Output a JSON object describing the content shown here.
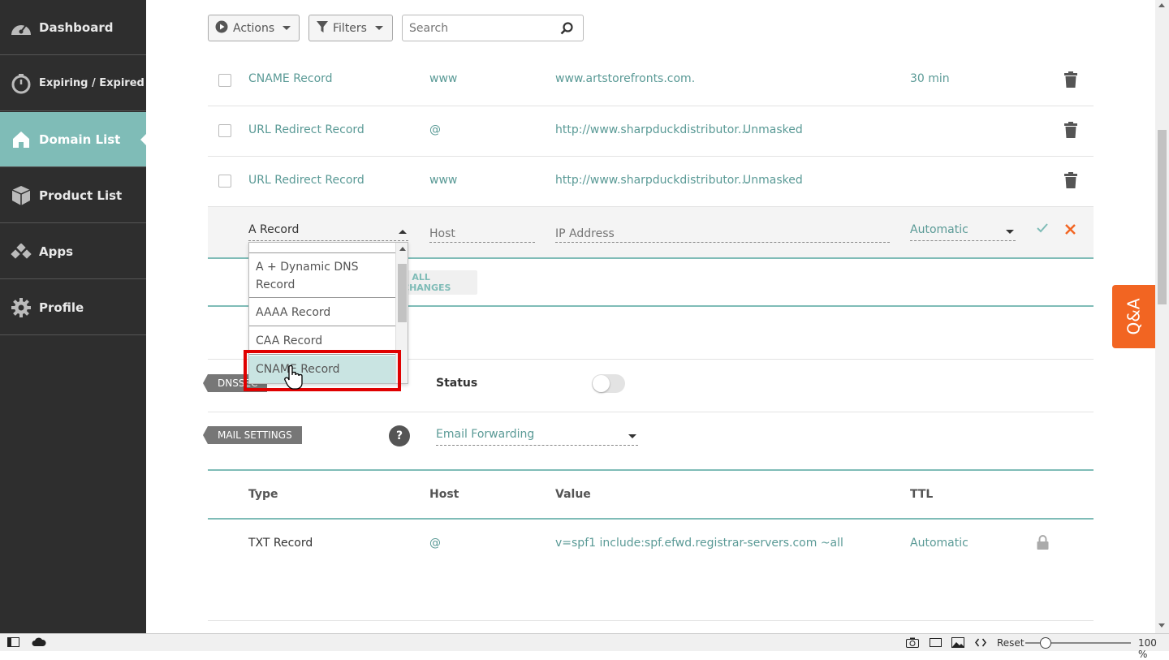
{
  "sidebar": {
    "items": [
      {
        "label": "Dashboard",
        "icon": "gauge-icon"
      },
      {
        "label": "Expiring / Expired",
        "icon": "timer-icon"
      },
      {
        "label": "Domain List",
        "icon": "home-icon",
        "active": true
      },
      {
        "label": "Product List",
        "icon": "box-icon"
      },
      {
        "label": "Apps",
        "icon": "apps-icon"
      },
      {
        "label": "Profile",
        "icon": "gear-icon"
      }
    ]
  },
  "toolbar": {
    "actions_label": "Actions",
    "filters_label": "Filters",
    "search_placeholder": "Search"
  },
  "records": [
    {
      "type": "CNAME Record",
      "host": "www",
      "value": "www.artstorefronts.com.",
      "extra": "",
      "ttl": "30 min"
    },
    {
      "type": "URL Redirect Record",
      "host": "@",
      "value": "http://www.sharpduckdistributor...",
      "extra": "Unmasked",
      "ttl": ""
    },
    {
      "type": "URL Redirect Record",
      "host": "www",
      "value": "http://www.sharpduckdistributor...",
      "extra": "Unmasked",
      "ttl": ""
    }
  ],
  "new_record": {
    "type_selected": "A Record",
    "host_placeholder": "Host",
    "value_placeholder": "IP Address",
    "ttl_selected": "Automatic"
  },
  "type_dropdown": {
    "options": [
      "A + Dynamic DNS Record",
      "AAAA Record",
      "CAA Record",
      "CNAME Record"
    ],
    "highlighted": "CNAME Record"
  },
  "save_all_label": "E ALL CHANGES",
  "dnssec": {
    "tag": "DNSSEC",
    "status_label": "Status",
    "enabled": false
  },
  "mail": {
    "tag": "MAIL SETTINGS",
    "help": "?",
    "selected": "Email Forwarding"
  },
  "mail_table": {
    "headers": [
      "Type",
      "Host",
      "Value",
      "TTL"
    ],
    "rows": [
      {
        "type": "TXT Record",
        "host": "@",
        "value": "v=spf1 include:spf.efwd.registrar-servers.com ~all",
        "ttl": "Automatic"
      }
    ]
  },
  "qa_label": "Q&A",
  "statusbar": {
    "reset": "Reset",
    "zoom": "100 %",
    "zoom_level": 0.2
  },
  "colors": {
    "sidebar_bg": "#2e2e2e",
    "active": "#7fbcb7",
    "teal": "#5a9a96",
    "orange": "#f26522",
    "highlight_box": "#e00000"
  }
}
